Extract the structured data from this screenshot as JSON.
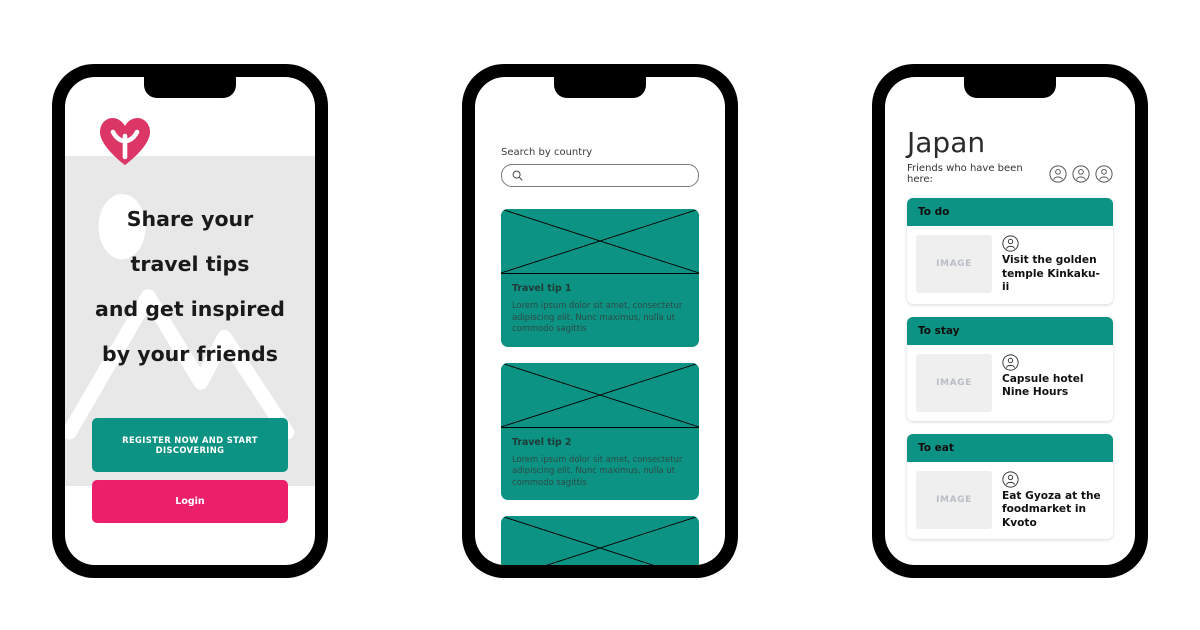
{
  "colors": {
    "teal": "#0d9383",
    "pink": "#ec1f6a",
    "panel_gray": "#e8e8e8",
    "frame_black": "#000000",
    "thumb_gray": "#efefef"
  },
  "phone1": {
    "logo": "heart-logo",
    "headline_lines": [
      "Share your",
      "travel tips",
      "and get inspired",
      "by your friends"
    ],
    "register_label": "REGISTER NOW AND START DISCOVERING",
    "login_label": "Login"
  },
  "phone2": {
    "search": {
      "label": "Search by country",
      "value": "",
      "placeholder": "",
      "icon": "search-icon"
    },
    "tips": [
      {
        "title": "Travel tip 1",
        "body": "Lorem ipsum dolor sit amet, consectetur adipiscing elit. Nunc maximus, nulla ut commodo sagittis",
        "image": "image-placeholder"
      },
      {
        "title": "Travel tip 2",
        "body": "Lorem ipsum dolor sit amet, consectetur adipiscing elit. Nunc maximus, nulla ut commodo sagittis",
        "image": "image-placeholder"
      },
      {
        "title": "",
        "body": "",
        "image": "image-placeholder"
      }
    ]
  },
  "phone3": {
    "country": "Japan",
    "friends_label": "Friends who have been here:",
    "friends_count": 3,
    "sections": [
      {
        "heading": "To do",
        "thumb_label": "IMAGE",
        "item_title": "Visit the golden temple Kinkaku-ii",
        "avatar": "person-icon"
      },
      {
        "heading": "To stay",
        "thumb_label": "IMAGE",
        "item_title": "Capsule hotel Nine Hours",
        "avatar": "person-icon"
      },
      {
        "heading": "To eat",
        "thumb_label": "IMAGE",
        "item_title": "Eat Gyoza at the foodmarket in Kvoto",
        "avatar": "person-icon"
      }
    ]
  }
}
